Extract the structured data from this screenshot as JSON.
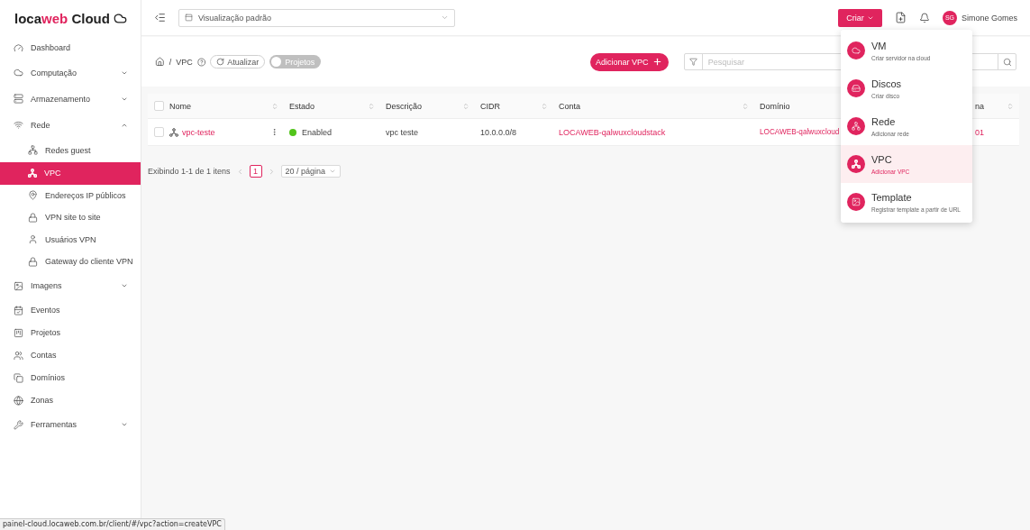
{
  "logo": {
    "prefix": "loca",
    "accent": "web",
    "suffix": "Cloud"
  },
  "sidebar": {
    "items": [
      {
        "label": "Dashboard",
        "kind": "link",
        "selected": false
      },
      {
        "label": "Computação",
        "kind": "group",
        "expanded": false,
        "selected": false
      },
      {
        "label": "Armazenamento",
        "kind": "group",
        "expanded": false,
        "selected": false
      },
      {
        "label": "Rede",
        "kind": "group",
        "expanded": true,
        "selected": false,
        "children": [
          {
            "label": "Redes guest",
            "selected": false
          },
          {
            "label": "VPC",
            "selected": true
          },
          {
            "label": "Endereços IP públicos",
            "selected": false
          },
          {
            "label": "VPN site to site",
            "selected": false
          },
          {
            "label": "Usuários VPN",
            "selected": false
          },
          {
            "label": "Gateway do cliente VPN",
            "selected": false
          }
        ]
      },
      {
        "label": "Imagens",
        "kind": "group",
        "expanded": false,
        "selected": false
      },
      {
        "label": "Eventos",
        "kind": "link",
        "selected": false
      },
      {
        "label": "Projetos",
        "kind": "link",
        "selected": false
      },
      {
        "label": "Contas",
        "kind": "link",
        "selected": false
      },
      {
        "label": "Domínios",
        "kind": "link",
        "selected": false
      },
      {
        "label": "Zonas",
        "kind": "link",
        "selected": false
      },
      {
        "label": "Ferramentas",
        "kind": "group",
        "expanded": false,
        "selected": false
      }
    ]
  },
  "header": {
    "view_select": "Visualização padrão",
    "create_button": "Criar",
    "user": {
      "initials": "SG",
      "name": "Simone Gomes"
    }
  },
  "toolbar": {
    "breadcrumb": [
      "VPC"
    ],
    "separator": "/",
    "refresh": "Atualizar",
    "projects_toggle": {
      "label": "Projetos",
      "on": false
    },
    "add_button": "Adicionar VPC",
    "search": {
      "placeholder": "Pesquisar"
    }
  },
  "table": {
    "all_selected": false,
    "columns": [
      "Nome",
      "Estado",
      "Descrição",
      "CIDR",
      "Conta",
      "Domínio",
      "na"
    ],
    "rows": [
      {
        "selected": false,
        "name": "vpc-teste",
        "state": "Enabled",
        "color": "#52c41a",
        "description": "vpc teste",
        "cidr": "10.0.0.0/8",
        "account": "LOCAWEB-qalwuxcloudstack",
        "domain": "LOCAWEB-qalwuxcloud",
        "column_7": "01"
      }
    ]
  },
  "pagination": {
    "summary": "Exibindo 1-1 de 1 itens",
    "pages": [
      {
        "label": "1",
        "selected": true
      }
    ],
    "page_size": "20 / página"
  },
  "create_menu": {
    "items": [
      {
        "title": "VM",
        "subtitle": "Criar servidor na cloud",
        "selected": false
      },
      {
        "title": "Discos",
        "subtitle": "Criar disco",
        "selected": false
      },
      {
        "title": "Rede",
        "subtitle": "Adicionar rede",
        "selected": false
      },
      {
        "title": "VPC",
        "subtitle": "Adicionar VPC",
        "selected": true
      },
      {
        "title": "Template",
        "subtitle": "Registrar template a partir de URL",
        "selected": false
      }
    ]
  },
  "status_bar": {
    "url": "painel-cloud.locaweb.com.br/client/#/vpc?action=createVPC"
  }
}
